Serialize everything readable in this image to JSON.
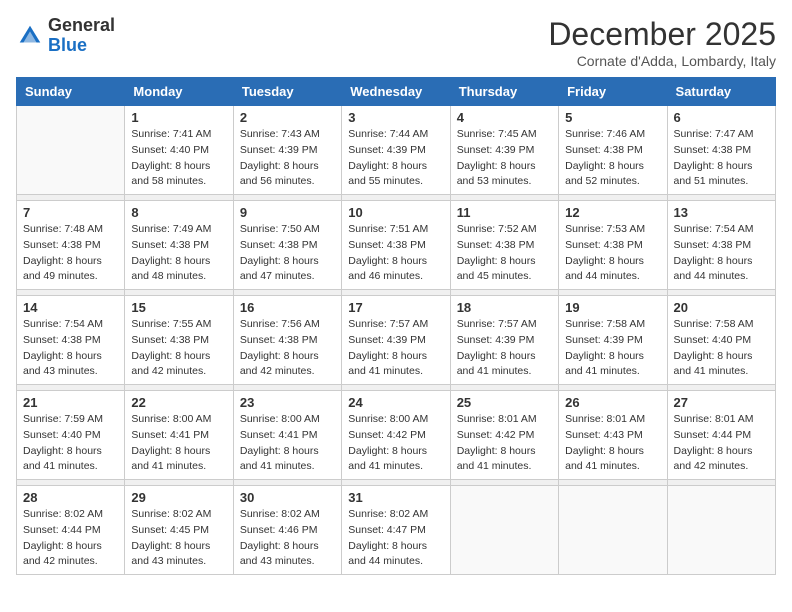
{
  "logo": {
    "general": "General",
    "blue": "Blue"
  },
  "header": {
    "title": "December 2025",
    "subtitle": "Cornate d'Adda, Lombardy, Italy"
  },
  "days_of_week": [
    "Sunday",
    "Monday",
    "Tuesday",
    "Wednesday",
    "Thursday",
    "Friday",
    "Saturday"
  ],
  "weeks": [
    {
      "days": [
        {
          "num": "",
          "sunrise": "",
          "sunset": "",
          "daylight": ""
        },
        {
          "num": "1",
          "sunrise": "Sunrise: 7:41 AM",
          "sunset": "Sunset: 4:40 PM",
          "daylight": "Daylight: 8 hours and 58 minutes."
        },
        {
          "num": "2",
          "sunrise": "Sunrise: 7:43 AM",
          "sunset": "Sunset: 4:39 PM",
          "daylight": "Daylight: 8 hours and 56 minutes."
        },
        {
          "num": "3",
          "sunrise": "Sunrise: 7:44 AM",
          "sunset": "Sunset: 4:39 PM",
          "daylight": "Daylight: 8 hours and 55 minutes."
        },
        {
          "num": "4",
          "sunrise": "Sunrise: 7:45 AM",
          "sunset": "Sunset: 4:39 PM",
          "daylight": "Daylight: 8 hours and 53 minutes."
        },
        {
          "num": "5",
          "sunrise": "Sunrise: 7:46 AM",
          "sunset": "Sunset: 4:38 PM",
          "daylight": "Daylight: 8 hours and 52 minutes."
        },
        {
          "num": "6",
          "sunrise": "Sunrise: 7:47 AM",
          "sunset": "Sunset: 4:38 PM",
          "daylight": "Daylight: 8 hours and 51 minutes."
        }
      ]
    },
    {
      "days": [
        {
          "num": "7",
          "sunrise": "Sunrise: 7:48 AM",
          "sunset": "Sunset: 4:38 PM",
          "daylight": "Daylight: 8 hours and 49 minutes."
        },
        {
          "num": "8",
          "sunrise": "Sunrise: 7:49 AM",
          "sunset": "Sunset: 4:38 PM",
          "daylight": "Daylight: 8 hours and 48 minutes."
        },
        {
          "num": "9",
          "sunrise": "Sunrise: 7:50 AM",
          "sunset": "Sunset: 4:38 PM",
          "daylight": "Daylight: 8 hours and 47 minutes."
        },
        {
          "num": "10",
          "sunrise": "Sunrise: 7:51 AM",
          "sunset": "Sunset: 4:38 PM",
          "daylight": "Daylight: 8 hours and 46 minutes."
        },
        {
          "num": "11",
          "sunrise": "Sunrise: 7:52 AM",
          "sunset": "Sunset: 4:38 PM",
          "daylight": "Daylight: 8 hours and 45 minutes."
        },
        {
          "num": "12",
          "sunrise": "Sunrise: 7:53 AM",
          "sunset": "Sunset: 4:38 PM",
          "daylight": "Daylight: 8 hours and 44 minutes."
        },
        {
          "num": "13",
          "sunrise": "Sunrise: 7:54 AM",
          "sunset": "Sunset: 4:38 PM",
          "daylight": "Daylight: 8 hours and 44 minutes."
        }
      ]
    },
    {
      "days": [
        {
          "num": "14",
          "sunrise": "Sunrise: 7:54 AM",
          "sunset": "Sunset: 4:38 PM",
          "daylight": "Daylight: 8 hours and 43 minutes."
        },
        {
          "num": "15",
          "sunrise": "Sunrise: 7:55 AM",
          "sunset": "Sunset: 4:38 PM",
          "daylight": "Daylight: 8 hours and 42 minutes."
        },
        {
          "num": "16",
          "sunrise": "Sunrise: 7:56 AM",
          "sunset": "Sunset: 4:38 PM",
          "daylight": "Daylight: 8 hours and 42 minutes."
        },
        {
          "num": "17",
          "sunrise": "Sunrise: 7:57 AM",
          "sunset": "Sunset: 4:39 PM",
          "daylight": "Daylight: 8 hours and 41 minutes."
        },
        {
          "num": "18",
          "sunrise": "Sunrise: 7:57 AM",
          "sunset": "Sunset: 4:39 PM",
          "daylight": "Daylight: 8 hours and 41 minutes."
        },
        {
          "num": "19",
          "sunrise": "Sunrise: 7:58 AM",
          "sunset": "Sunset: 4:39 PM",
          "daylight": "Daylight: 8 hours and 41 minutes."
        },
        {
          "num": "20",
          "sunrise": "Sunrise: 7:58 AM",
          "sunset": "Sunset: 4:40 PM",
          "daylight": "Daylight: 8 hours and 41 minutes."
        }
      ]
    },
    {
      "days": [
        {
          "num": "21",
          "sunrise": "Sunrise: 7:59 AM",
          "sunset": "Sunset: 4:40 PM",
          "daylight": "Daylight: 8 hours and 41 minutes."
        },
        {
          "num": "22",
          "sunrise": "Sunrise: 8:00 AM",
          "sunset": "Sunset: 4:41 PM",
          "daylight": "Daylight: 8 hours and 41 minutes."
        },
        {
          "num": "23",
          "sunrise": "Sunrise: 8:00 AM",
          "sunset": "Sunset: 4:41 PM",
          "daylight": "Daylight: 8 hours and 41 minutes."
        },
        {
          "num": "24",
          "sunrise": "Sunrise: 8:00 AM",
          "sunset": "Sunset: 4:42 PM",
          "daylight": "Daylight: 8 hours and 41 minutes."
        },
        {
          "num": "25",
          "sunrise": "Sunrise: 8:01 AM",
          "sunset": "Sunset: 4:42 PM",
          "daylight": "Daylight: 8 hours and 41 minutes."
        },
        {
          "num": "26",
          "sunrise": "Sunrise: 8:01 AM",
          "sunset": "Sunset: 4:43 PM",
          "daylight": "Daylight: 8 hours and 41 minutes."
        },
        {
          "num": "27",
          "sunrise": "Sunrise: 8:01 AM",
          "sunset": "Sunset: 4:44 PM",
          "daylight": "Daylight: 8 hours and 42 minutes."
        }
      ]
    },
    {
      "days": [
        {
          "num": "28",
          "sunrise": "Sunrise: 8:02 AM",
          "sunset": "Sunset: 4:44 PM",
          "daylight": "Daylight: 8 hours and 42 minutes."
        },
        {
          "num": "29",
          "sunrise": "Sunrise: 8:02 AM",
          "sunset": "Sunset: 4:45 PM",
          "daylight": "Daylight: 8 hours and 43 minutes."
        },
        {
          "num": "30",
          "sunrise": "Sunrise: 8:02 AM",
          "sunset": "Sunset: 4:46 PM",
          "daylight": "Daylight: 8 hours and 43 minutes."
        },
        {
          "num": "31",
          "sunrise": "Sunrise: 8:02 AM",
          "sunset": "Sunset: 4:47 PM",
          "daylight": "Daylight: 8 hours and 44 minutes."
        },
        {
          "num": "",
          "sunrise": "",
          "sunset": "",
          "daylight": ""
        },
        {
          "num": "",
          "sunrise": "",
          "sunset": "",
          "daylight": ""
        },
        {
          "num": "",
          "sunrise": "",
          "sunset": "",
          "daylight": ""
        }
      ]
    }
  ]
}
